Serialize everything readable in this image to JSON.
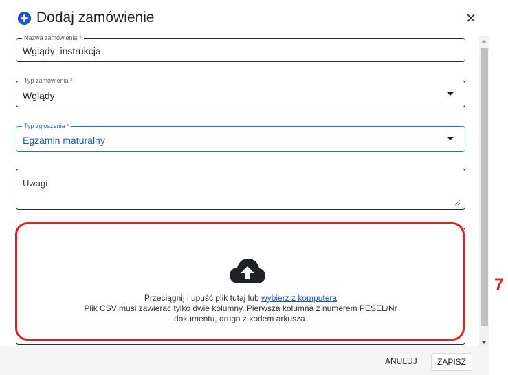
{
  "dialog": {
    "title": "Dodaj zamówienie",
    "icons": {
      "title": "add-circle-icon",
      "close": "close-icon",
      "upload": "cloud-upload-icon"
    }
  },
  "fields": {
    "name": {
      "label": "Nazwa zamówienia",
      "required_mark": "*",
      "value": "Wglądy_instrukcja"
    },
    "order_type": {
      "label": "Typ zamówienia",
      "required_mark": "*",
      "value": "Wglądy"
    },
    "report_type": {
      "label": "Typ zgłoszenia",
      "required_mark": "*",
      "value": "Egzamin maturalny"
    },
    "notes": {
      "placeholder": "Uwagi",
      "value": ""
    }
  },
  "dropzone": {
    "text_before": "Przeciągnij i upuść plik tutaj lub ",
    "link": "wybierz z komputera",
    "hint_line1": "Plik CSV musi zawierać tylko dwie kolumny. Pierwsza kolumna z numerem PESEL/Nr",
    "hint_line2": "dokumentu, druga z kodem arkusza."
  },
  "annotation": {
    "number": "7",
    "color": "#e02020"
  },
  "footer": {
    "cancel": "ANULUJ",
    "save": "ZAPISZ"
  },
  "colors": {
    "accent": "#1a73e8",
    "link": "#1a56c4",
    "highlight": "#e02020"
  }
}
